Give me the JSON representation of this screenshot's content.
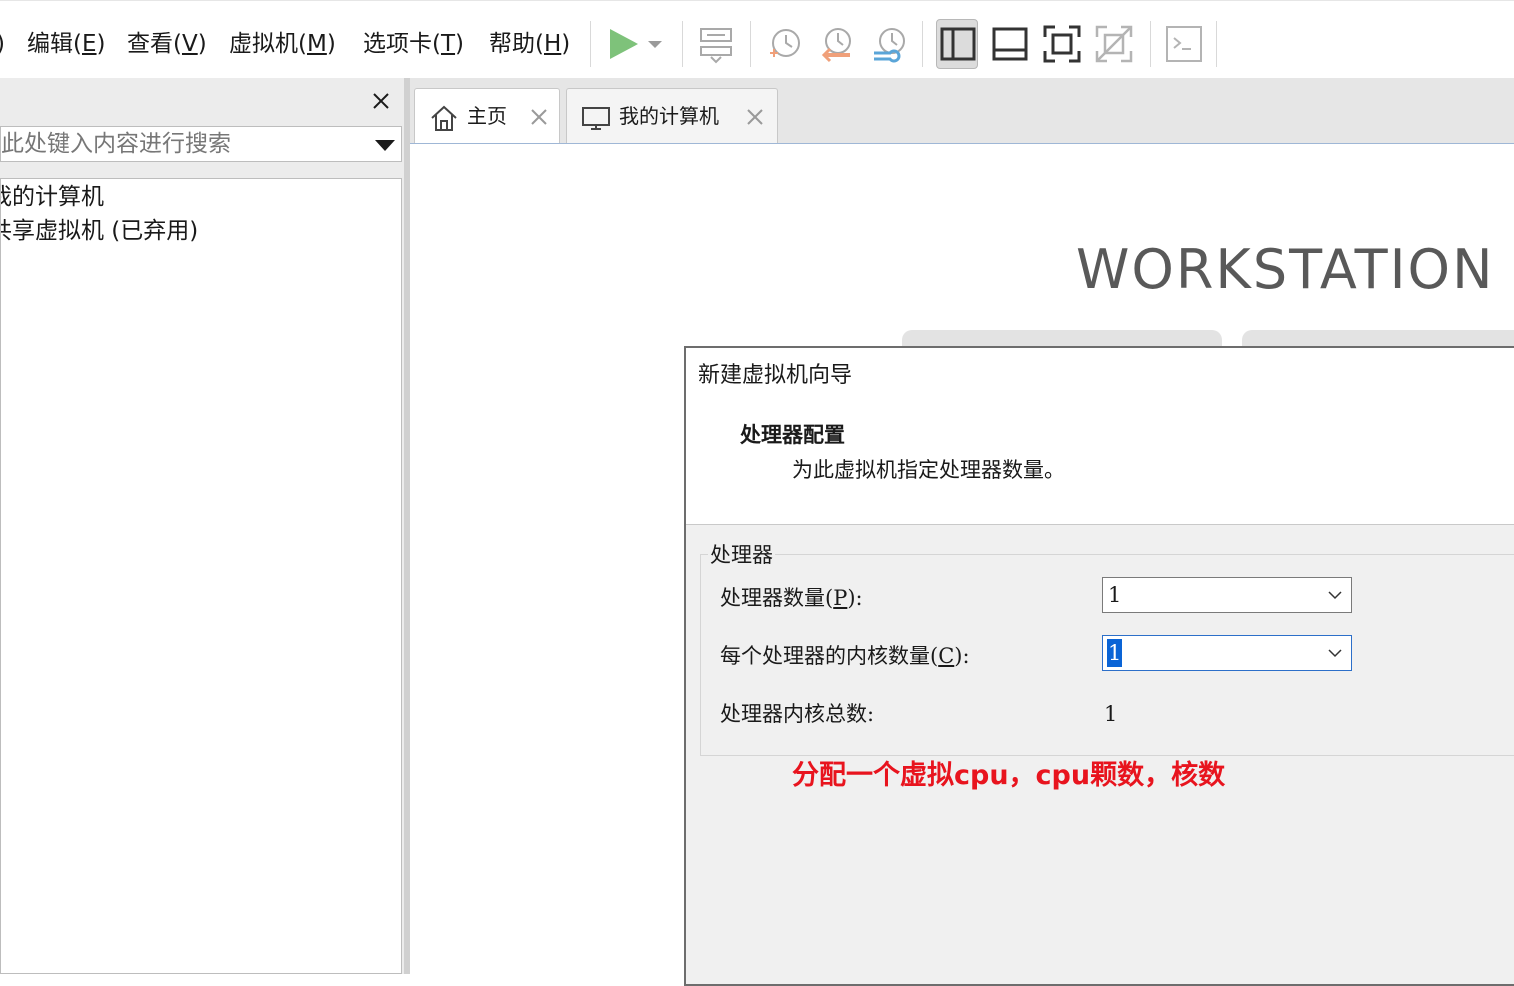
{
  "menubar": {
    "partial_left": ")",
    "items": [
      {
        "label": "编辑(",
        "key": "E",
        "suffix": ")"
      },
      {
        "label": "查看(",
        "key": "V",
        "suffix": ")"
      },
      {
        "label": "虚拟机(",
        "key": "M",
        "suffix": ")"
      },
      {
        "label": "选项卡(",
        "key": "T",
        "suffix": ")"
      },
      {
        "label": "帮助(",
        "key": "H",
        "suffix": ")"
      }
    ]
  },
  "toolbar": {
    "icons": [
      "play-icon",
      "play-dropdown-icon",
      "send-keys-icon",
      "snapshot-take-icon",
      "snapshot-revert-icon",
      "snapshot-manager-icon",
      "library-layout-icon",
      "thumbnail-layout-icon",
      "fullscreen-icon",
      "unity-icon",
      "console-icon"
    ],
    "play_color": "#7ec27a"
  },
  "sidebar": {
    "search_placeholder": "此处键入内容进行搜索",
    "tree": [
      {
        "label": "我的计算机"
      },
      {
        "label": "共享虚拟机 (已弃用)"
      }
    ]
  },
  "tabs": [
    {
      "label": "主页",
      "icon": "home-icon"
    },
    {
      "label": "我的计算机",
      "icon": "monitor-icon"
    }
  ],
  "home": {
    "brand": "WORKSTATION"
  },
  "dialog": {
    "title": "新建虚拟机向导",
    "heading": "处理器配置",
    "description": "为此虚拟机指定处理器数量。",
    "group_label": "处理器",
    "fields": {
      "processor_count": {
        "label": "处理器数量(",
        "key": "P",
        "suffix": "):",
        "value": "1"
      },
      "cores_per_processor": {
        "label": "每个处理器的内核数量(",
        "key": "C",
        "suffix": "):",
        "value": "1"
      },
      "total_cores": {
        "label": "处理器内核总数:",
        "value": "1"
      }
    },
    "annotation": "分配一个虚拟cpu，cpu颗数，核数",
    "annotation_color": "#e8141e"
  }
}
